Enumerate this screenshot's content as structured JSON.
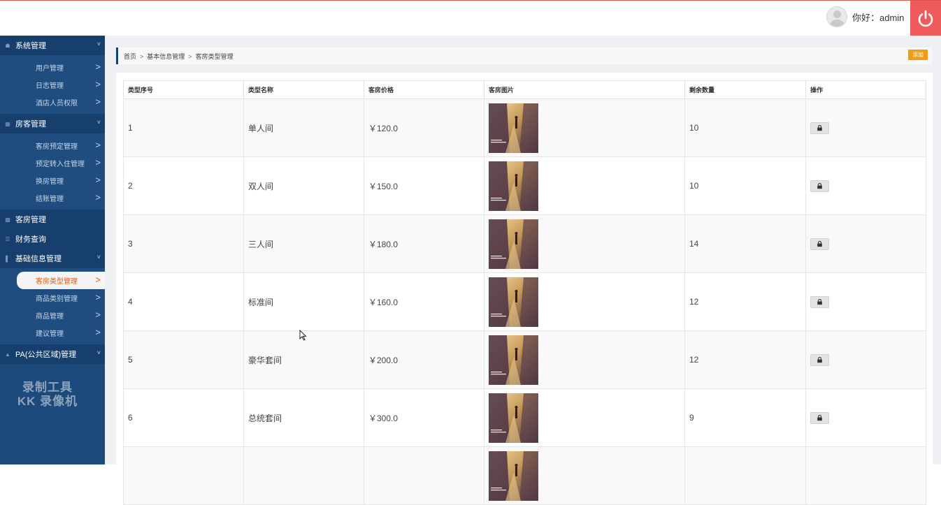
{
  "header": {
    "greeting": "你好：admin",
    "accent_color": "#ef5b5b"
  },
  "sidebar": {
    "groups": [
      {
        "label": "系统管理",
        "icon": "home-icon",
        "items": [
          {
            "label": "用户管理",
            "arrow": ">"
          },
          {
            "label": "日志管理",
            "arrow": ">"
          },
          {
            "label": "酒店人员权限",
            "arrow": ">"
          }
        ]
      },
      {
        "label": "房客管理",
        "icon": "grid-icon",
        "items": [
          {
            "label": "客房预定管理",
            "arrow": ">"
          },
          {
            "label": "预定转入住管理",
            "arrow": ">"
          },
          {
            "label": "换房管理",
            "arrow": ">"
          },
          {
            "label": "结账管理",
            "arrow": ">"
          }
        ]
      },
      {
        "label": "客房管理",
        "icon": "calendar-icon",
        "items": []
      },
      {
        "label": "财务查询",
        "icon": "list-icon",
        "items": []
      },
      {
        "label": "基础信息管理",
        "icon": "bar-chart-icon",
        "items": [
          {
            "label": "客房类型管理",
            "arrow": ">",
            "active": true
          },
          {
            "label": "商品类别管理",
            "arrow": ">"
          },
          {
            "label": "商品管理",
            "arrow": ">"
          },
          {
            "label": "建议管理",
            "arrow": ">"
          }
        ]
      },
      {
        "label": "PA(公共区域)管理",
        "icon": "warning-icon",
        "items": []
      }
    ],
    "watermark": [
      "录制工具",
      "KK 录像机"
    ]
  },
  "breadcrumb": {
    "items": [
      "首页",
      "基本信息管理",
      "客房类型管理"
    ],
    "separator": ">"
  },
  "add_button": "添加",
  "table": {
    "columns": [
      "类型序号",
      "类型名称",
      "客房价格",
      "客房图片",
      "剩余数量",
      "操作"
    ],
    "rows": [
      {
        "id": "1",
        "name": "单人间",
        "price": "￥120.0",
        "remaining": "10"
      },
      {
        "id": "2",
        "name": "双人间",
        "price": "￥150.0",
        "remaining": "10"
      },
      {
        "id": "3",
        "name": "三人间",
        "price": "￥180.0",
        "remaining": "14"
      },
      {
        "id": "4",
        "name": "标准间",
        "price": "￥160.0",
        "remaining": "12"
      },
      {
        "id": "5",
        "name": "豪华套间",
        "price": "￥200.0",
        "remaining": "12"
      },
      {
        "id": "6",
        "name": "总统套间",
        "price": "￥300.0",
        "remaining": "9"
      },
      {
        "id": "",
        "name": "",
        "price": "",
        "remaining": ""
      }
    ]
  }
}
